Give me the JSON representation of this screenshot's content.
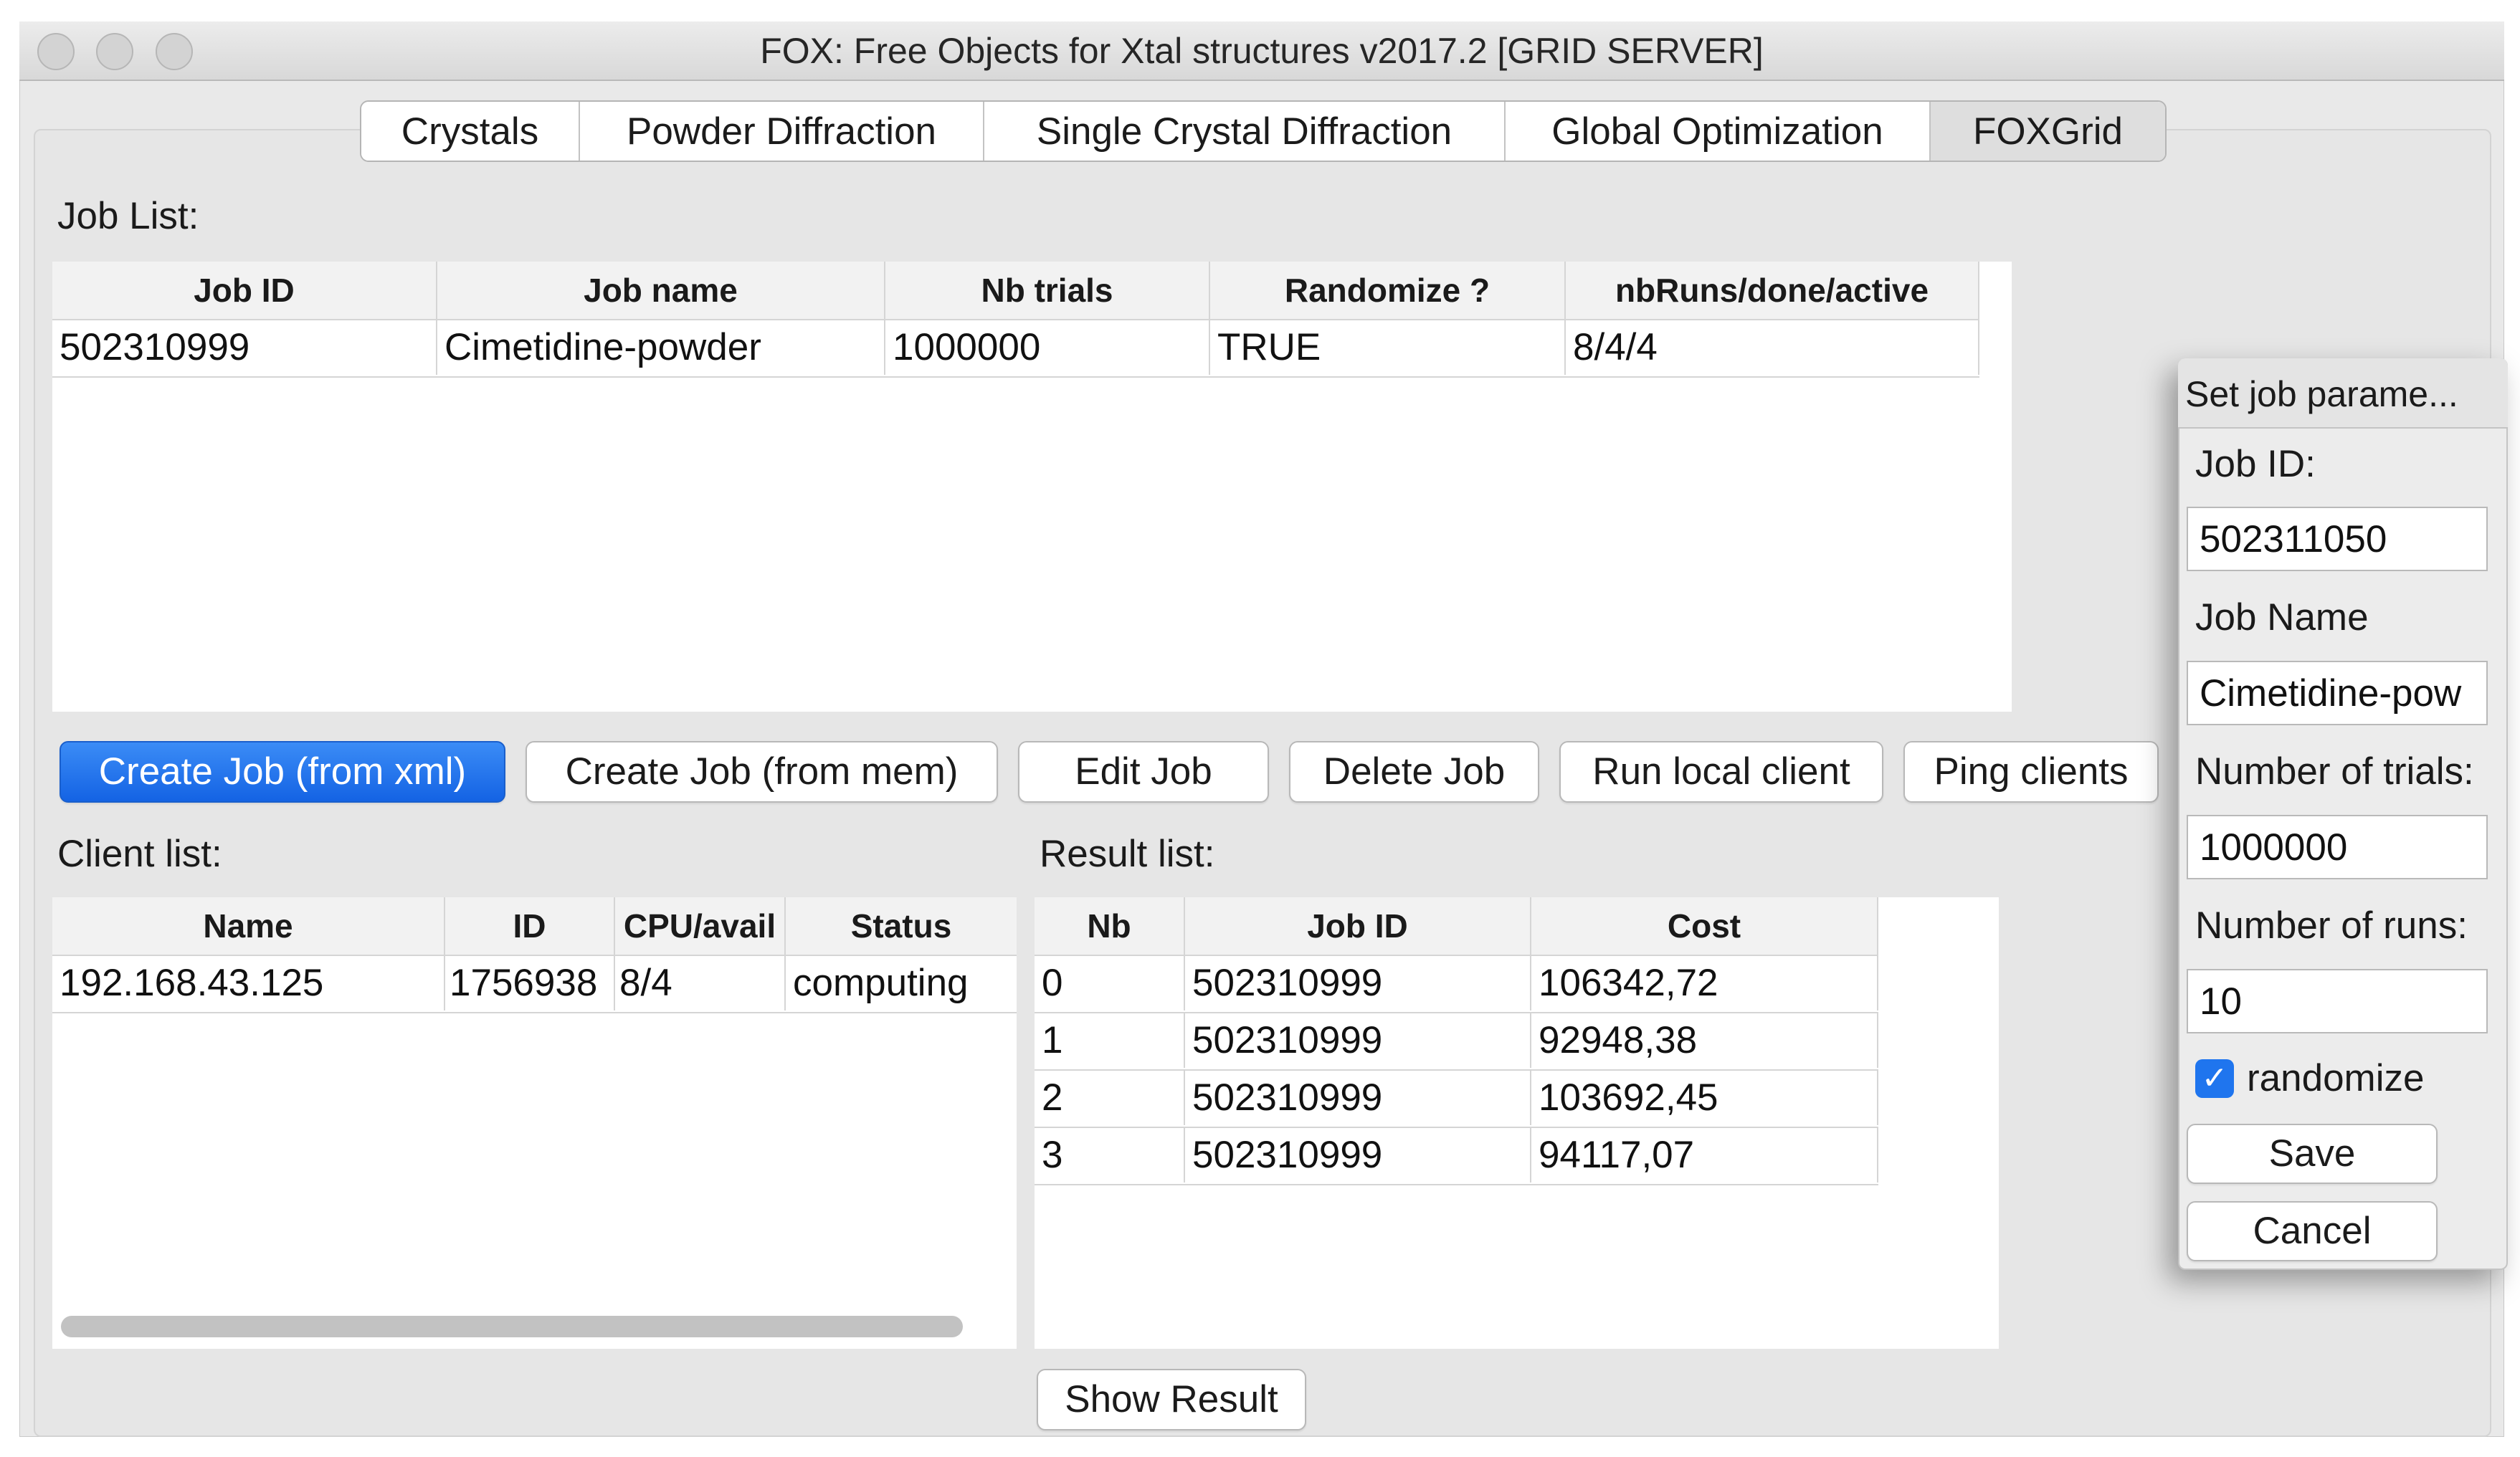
{
  "window": {
    "title": "FOX: Free Objects for Xtal structures v2017.2 [GRID SERVER]"
  },
  "tabs": [
    {
      "label": "Crystals"
    },
    {
      "label": "Powder Diffraction"
    },
    {
      "label": "Single Crystal Diffraction"
    },
    {
      "label": "Global Optimization"
    },
    {
      "label": "FOXGrid",
      "active": true
    }
  ],
  "job_list": {
    "label": "Job List:",
    "columns": [
      "Job ID",
      "Job name",
      "Nb trials",
      "Randomize ?",
      "nbRuns/done/active"
    ],
    "rows": [
      [
        "502310999",
        "Cimetidine-powder",
        "1000000",
        "TRUE",
        "8/4/4"
      ]
    ]
  },
  "buttons": {
    "create_xml": "Create Job (from xml)",
    "create_mem": "Create Job (from mem)",
    "edit": "Edit Job",
    "delete": "Delete Job",
    "run_local": "Run local client",
    "ping": "Ping clients",
    "show_result": "Show Result"
  },
  "client_list": {
    "label": "Client list:",
    "columns": [
      "Name",
      "ID",
      "CPU/avail",
      "Status"
    ],
    "rows": [
      [
        "192.168.43.125",
        "1756938",
        "8/4",
        "computing"
      ]
    ]
  },
  "result_list": {
    "label": "Result list:",
    "columns": [
      "Nb",
      "Job ID",
      "Cost"
    ],
    "rows": [
      [
        "0",
        "502310999",
        "106342,72"
      ],
      [
        "1",
        "502310999",
        "92948,38"
      ],
      [
        "2",
        "502310999",
        "103692,45"
      ],
      [
        "3",
        "502310999",
        "94117,07"
      ]
    ]
  },
  "dialog": {
    "title": "Set job parame...",
    "job_id_label": "Job ID:",
    "job_id_value": "502311050",
    "job_name_label": "Job Name",
    "job_name_value": "Cimetidine-pow",
    "trials_label": "Number of trials:",
    "trials_value": "1000000",
    "runs_label": "Number of runs:",
    "runs_value": "10",
    "randomize_label": "randomize",
    "randomize_checked": true,
    "save": "Save",
    "cancel": "Cancel"
  },
  "colors": {
    "accent": "#1f75ee",
    "window_bg": "#e9e9e9"
  }
}
